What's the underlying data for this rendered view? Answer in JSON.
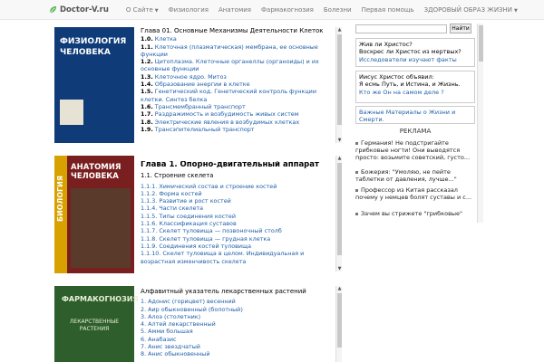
{
  "navbar": {
    "brand": "Doctor-V.ru",
    "items": [
      {
        "label": "О Сайте",
        "dropdown": true
      },
      {
        "label": "Физиология",
        "dropdown": false
      },
      {
        "label": "Анатомия",
        "dropdown": false
      },
      {
        "label": "Фармакогнозия",
        "dropdown": false
      },
      {
        "label": "Болезни",
        "dropdown": false
      },
      {
        "label": "Первая помощь",
        "dropdown": false
      },
      {
        "label": "ЗДОРОВЫЙ ОБРАЗ ЖИЗНИ",
        "dropdown": true
      }
    ]
  },
  "books": [
    {
      "cover_title": "ФИЗИОЛОГИЯ ЧЕЛОВЕКА",
      "heading": "Глава 01. Основные Механизмы Деятельности Клеток",
      "subheading": "",
      "items": [
        {
          "num": "1.0.",
          "text": "Клетка"
        },
        {
          "num": "1.1.",
          "text": "Клеточная (плазматическая) мембрана, ее основные функции"
        },
        {
          "num": "1.2.",
          "text": "Цитоплазма. Клеточные органеллы (органоиды) и их основные функции"
        },
        {
          "num": "1.3.",
          "text": "Клеточное ядро. Митоз"
        },
        {
          "num": "1.4.",
          "text": "Образование энергии в клетке"
        },
        {
          "num": "1.5.",
          "text": "Генетический код. Генетический контроль функции клетки. Синтез белка"
        },
        {
          "num": "1.6.",
          "text": "Трансмембранный транспорт"
        },
        {
          "num": "1.7.",
          "text": "Раздражимость и возбудимость живых систем"
        },
        {
          "num": "1.8.",
          "text": "Электрические явления в возбудимых клетках"
        },
        {
          "num": "1.9.",
          "text": "Трансэпителиальный транспорт"
        }
      ]
    },
    {
      "cover_title": "АНАТОМИЯ ЧЕЛОВЕКА",
      "cover_side": "БИОЛОГИЯ",
      "heading": "Глава 1. Опорно-двигательный аппарат",
      "subheading": "1.1. Строение скелета",
      "items": [
        {
          "num": "1.1.1.",
          "text": "Химический состав и строение костей"
        },
        {
          "num": "1.1.2.",
          "text": "Форма костей"
        },
        {
          "num": "1.1.3.",
          "text": "Развитие и рост костей"
        },
        {
          "num": "1.1.4.",
          "text": "Части скелета"
        },
        {
          "num": "1.1.5.",
          "text": "Типы соединения костей"
        },
        {
          "num": "1.1.6.",
          "text": "Классификация суставов"
        },
        {
          "num": "1.1.7.",
          "text": "Скелет туловища — позвоночный столб"
        },
        {
          "num": "1.1.8.",
          "text": "Скелет туловища — грудная клетка"
        },
        {
          "num": "1.1.9.",
          "text": "Соединения костей туловища"
        },
        {
          "num": "1.1.10.",
          "text": "Скелет туловища в целом. Индивидуальная и возрастная изменчивость скелета"
        }
      ]
    },
    {
      "cover_title": "ФАРМАКОГНОЗИЯ",
      "cover_sub": "ЛЕКАРСТВЕННЫЕ РАСТЕНИЯ",
      "heading": "Алфавитный указатель лекарственных растений",
      "subheading": "",
      "items": [
        {
          "num": "1.",
          "text": "Адонис (горицвет) весенний"
        },
        {
          "num": "2.",
          "text": "Аир обыкновенный (болотный)"
        },
        {
          "num": "3.",
          "text": "Алоэ (столетник)"
        },
        {
          "num": "4.",
          "text": "Алтей лекарственный"
        },
        {
          "num": "5.",
          "text": "Амми большая"
        },
        {
          "num": "6.",
          "text": "Анабазис"
        },
        {
          "num": "7.",
          "text": "Анис звездчатый"
        },
        {
          "num": "8.",
          "text": "Анис обыкновенный"
        }
      ]
    }
  ],
  "sidebar": {
    "search_button": "Найти",
    "search_value": "",
    "box1": {
      "title": "Жив ли Христос?",
      "line": "Воскрес ли Христос из мертвых?",
      "link": "Исследователи изучают факты"
    },
    "box2": {
      "lines": [
        "Иисус Христос объявил:",
        "Я есмь Путь, и Истина, и Жизнь."
      ],
      "link": "Кто же Он на самом деле ?"
    },
    "box3": {
      "link": "Важные Материалы о Жизни и Смерти."
    },
    "ads_title": "РЕКЛАМА",
    "ads": [
      "Германия! Не подстригайте грибковые ногти! Они выводятся просто: возьмите советский, густо...",
      "Божерия: \"Умоляю, не пейте таблетки от давления, лучше...\"",
      "Профессор из Китая рассказал почему у немцев болят суставы и с...",
      "Зачем вы стрижете \"грибковые\""
    ]
  }
}
